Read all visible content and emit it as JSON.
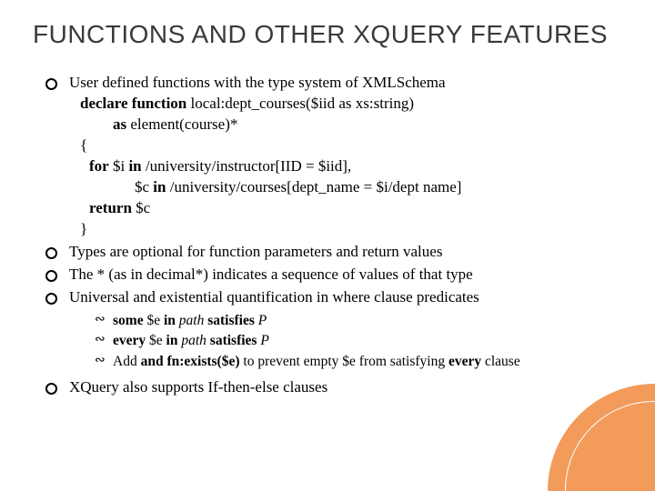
{
  "title": "FUNCTIONS AND OTHER XQUERY FEATURES",
  "items": {
    "i0": {
      "lead": "User defined functions with the type system of XMLSchema",
      "code": {
        "l0a": "declare function",
        "l0b": " local:dept_courses($iid as xs:string)",
        "l1a": "as",
        "l1b": " element(course)*",
        "l2": "{",
        "l3a": "for",
        "l3b": " $i ",
        "l3c": "in",
        "l3d": " /university/instructor[IID = $iid],",
        "l4a": "$c ",
        "l4b": "in",
        "l4c": " /university/courses[dept_name = $i/dept name]",
        "l5a": "return",
        "l5b": " $c",
        "l6": "}"
      }
    },
    "i1": "Types are optional for function parameters and return values",
    "i2": "The * (as in decimal*) indicates a sequence of values of that type",
    "i3": "Universal and existential quantification in where clause predicates",
    "sub": {
      "s0a": "some",
      "s0b": " $e ",
      "s0c": "in",
      "s0d": " path ",
      "s0e": "satisfies",
      "s0f": " P",
      "s1a": "every",
      "s1b": " $e ",
      "s1c": "in",
      "s1d": " path ",
      "s1e": "satisfies",
      "s1f": " P",
      "s2a": "Add ",
      "s2b": "and fn:exists($e) ",
      "s2c": "to prevent empty $e from satisfying ",
      "s2d": "every ",
      "s2e": "clause"
    },
    "i4": "XQuery also supports If-then-else clauses"
  }
}
